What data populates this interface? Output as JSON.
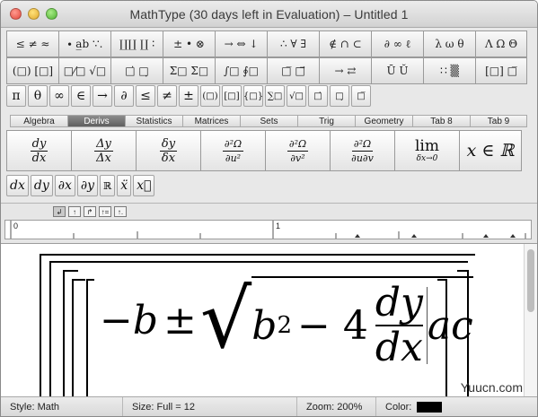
{
  "window": {
    "title": "MathType (30 days left in Evaluation) – Untitled 1"
  },
  "palette": {
    "row1": [
      "≤ ≠ ≈",
      "∙ a̲b ∵.",
      "∐∐ ∐ ∶",
      "± • ⊗",
      "→ ⇔ ↓",
      "∴ ∀ ∃",
      "∉ ∩ ⊂",
      "∂ ∞ ℓ",
      "λ ω θ",
      "Λ Ω Θ"
    ],
    "row2": [
      "(□) [□]",
      "□⁄□ √□",
      "□̇ □̣",
      "Σ□ Σ□",
      "∫□ ∮□",
      "□̅ □⃗",
      "→ ⇄",
      "Ū Ŭ",
      "∷ ▒",
      "[□] □̅"
    ]
  },
  "symbols": [
    "π",
    "θ",
    "∞",
    "∈",
    "→",
    "∂",
    "≤",
    "≠",
    "±",
    "(□)",
    "[□]",
    "{□}",
    "∑□",
    "√□",
    "□̇",
    "□̣",
    "□̅"
  ],
  "tabs": [
    "Algebra",
    "Derivs",
    "Statistics",
    "Matrices",
    "Sets",
    "Trig",
    "Geometry",
    "Tab 8",
    "Tab 9"
  ],
  "active_tab": "Derivs",
  "templates": {
    "t1_num": "dy",
    "t1_den": "dx",
    "t2_num": "Δy",
    "t2_den": "Δx",
    "t3_num": "δy",
    "t3_den": "δx",
    "t4_num": "∂²Ω",
    "t4_den": "∂u²",
    "t5_num": "∂²Ω",
    "t5_den": "∂v²",
    "t6_num": "∂²Ω",
    "t6_den": "∂u∂v",
    "t7_top": "lim",
    "t7_sub": "δx→0",
    "t8": "x ∈ ℝ"
  },
  "deriv_small": [
    "dx",
    "dy",
    "∂x",
    "∂y",
    "ℝ",
    "ẍ",
    "x⃛"
  ],
  "ruler": {
    "n0": "0",
    "n1": "1"
  },
  "equation": {
    "minus_b": "−b",
    "pm": "±",
    "radical": "√",
    "b": "b",
    "exp": "2",
    "minus4": "− 4",
    "num": "dy",
    "den": "dx",
    "ac": "ac"
  },
  "status": {
    "style": "Style: Math",
    "size": "Size: Full = 12",
    "zoom": "Zoom: 200%",
    "color_label": "Color:",
    "color_value": "#000000"
  },
  "watermark": "Yuucn.com"
}
